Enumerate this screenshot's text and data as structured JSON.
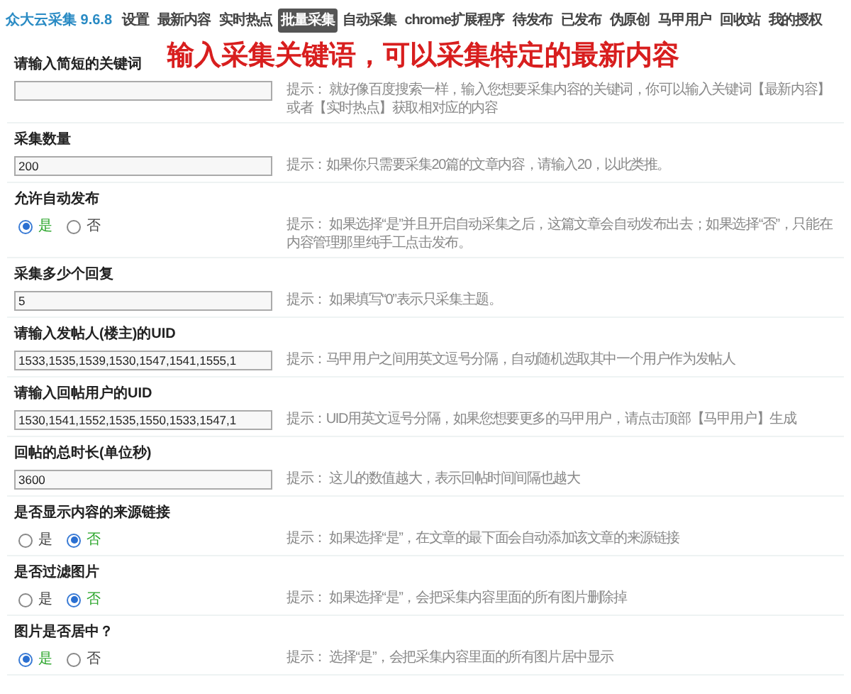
{
  "app_title": "众大云采集 9.6.8",
  "nav": [
    {
      "label": "设置",
      "selected": false
    },
    {
      "label": "最新内容",
      "selected": false
    },
    {
      "label": "实时热点",
      "selected": false
    },
    {
      "label": "批量采集",
      "selected": true
    },
    {
      "label": "自动采集",
      "selected": false
    },
    {
      "label": "chrome扩展程序",
      "selected": false
    },
    {
      "label": "待发布",
      "selected": false
    },
    {
      "label": "已发布",
      "selected": false
    },
    {
      "label": "伪原创",
      "selected": false
    },
    {
      "label": "马甲用户",
      "selected": false
    },
    {
      "label": "回收站",
      "selected": false
    },
    {
      "label": "我的授权",
      "selected": false
    }
  ],
  "banner": "输入采集关键语，可以采集特定的最新内容",
  "fields": [
    {
      "label": "请输入简短的关键词",
      "kind": "text",
      "hint": "提示： 就好像百度搜索一样，输入您想要采集内容的关键词，你可以输入关键词【最新内容】或者【实时热点】获取相对应的内容"
    },
    {
      "label": "采集数量",
      "kind": "text",
      "value": "200",
      "hint": "提示：如果你只需要采集20篇的文章内容，请输入20，以此类推。"
    },
    {
      "label": "允许自动发布",
      "kind": "radio",
      "options": [
        {
          "label": "是",
          "selected": true
        },
        {
          "label": "否",
          "selected": false
        }
      ],
      "hint": "提示： 如果选择“是”并且开启自动采集之后，这篇文章会自动发布出去；如果选择“否”，只能在内容管理那里纯手工点击发布。"
    },
    {
      "label": "采集多少个回复",
      "kind": "text",
      "value": "5",
      "hint": "提示： 如果填写“0”表示只采集主题。"
    },
    {
      "label": "请输入发帖人(楼主)的UID",
      "kind": "text",
      "value": "1533,1535,1539,1530,1547,1541,1555,1",
      "hint": "提示：马甲用户之间用英文逗号分隔，自动随机选取其中一个用户作为发帖人"
    },
    {
      "label": "请输入回帖用户的UID",
      "kind": "text",
      "value": "1530,1541,1552,1535,1550,1533,1547,1",
      "hint": "提示：UID用英文逗号分隔，如果您想要更多的马甲用户，请点击顶部【马甲用户】生成"
    },
    {
      "label": "回帖的总时长(单位秒)",
      "kind": "text",
      "value": "3600",
      "hint": "提示： 这儿的数值越大，表示回帖时间间隔也越大"
    },
    {
      "label": "是否显示内容的来源链接",
      "kind": "radio",
      "options": [
        {
          "label": "是",
          "selected": false
        },
        {
          "label": "否",
          "selected": true
        }
      ],
      "hint": "提示： 如果选择“是”，在文章的最下面会自动添加该文章的来源链接"
    },
    {
      "label": "是否过滤图片",
      "kind": "radio",
      "options": [
        {
          "label": "是",
          "selected": false
        },
        {
          "label": "否",
          "selected": true
        }
      ],
      "hint": "提示： 如果选择“是”，会把采集内容里面的所有图片删除掉"
    },
    {
      "label": "图片是否居中？",
      "kind": "radio",
      "options": [
        {
          "label": "是",
          "selected": true
        },
        {
          "label": "否",
          "selected": false
        }
      ],
      "hint": "提示： 选择“是”，会把采集内容里面的所有图片居中显示"
    }
  ]
}
